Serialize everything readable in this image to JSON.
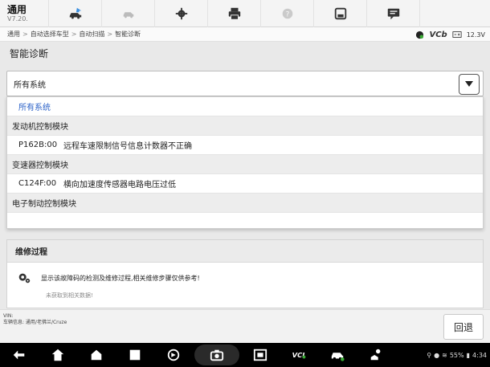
{
  "app": {
    "title": "通用",
    "version": "V7.20."
  },
  "toolbar": [
    "car-home-icon",
    "vehicle-swap-icon",
    "settings-gear-icon",
    "print-icon",
    "help-icon",
    "save-icon",
    "message-icon"
  ],
  "breadcrumb": [
    "通用",
    "自动选择车型",
    "自动扫描",
    "智能诊断"
  ],
  "status": {
    "vcb_label": "VCb",
    "voltage": "12.3V"
  },
  "page": {
    "title": "智能诊断"
  },
  "select": {
    "value": "所有系统"
  },
  "dropdown": {
    "items": [
      {
        "type": "selected",
        "label": "所有系统"
      },
      {
        "type": "group",
        "label": "发动机控制模块"
      },
      {
        "type": "code",
        "code": "P162B:00",
        "desc": "远程车速限制信号信息计数器不正确"
      },
      {
        "type": "group",
        "label": "变速器控制模块"
      },
      {
        "type": "code",
        "code": "C124F:00",
        "desc": "横向加速度传感器电路电压过低"
      },
      {
        "type": "group",
        "label": "电子制动控制模块"
      }
    ]
  },
  "repair": {
    "title": "维修过程",
    "text": "显示该故障码的检测及维修过程,相关维修步骤仅供参考!",
    "note": "未获取到相关数据!"
  },
  "footer": {
    "vin_label": "VIN:",
    "vehicle_info": "车辆信息: 通用/老佛兰/Cruze",
    "back_label": "回退"
  },
  "system": {
    "battery": "55%",
    "time": "4:34"
  },
  "colors": {
    "accent": "#2d63c8",
    "vcb_green": "#3aaa35"
  }
}
